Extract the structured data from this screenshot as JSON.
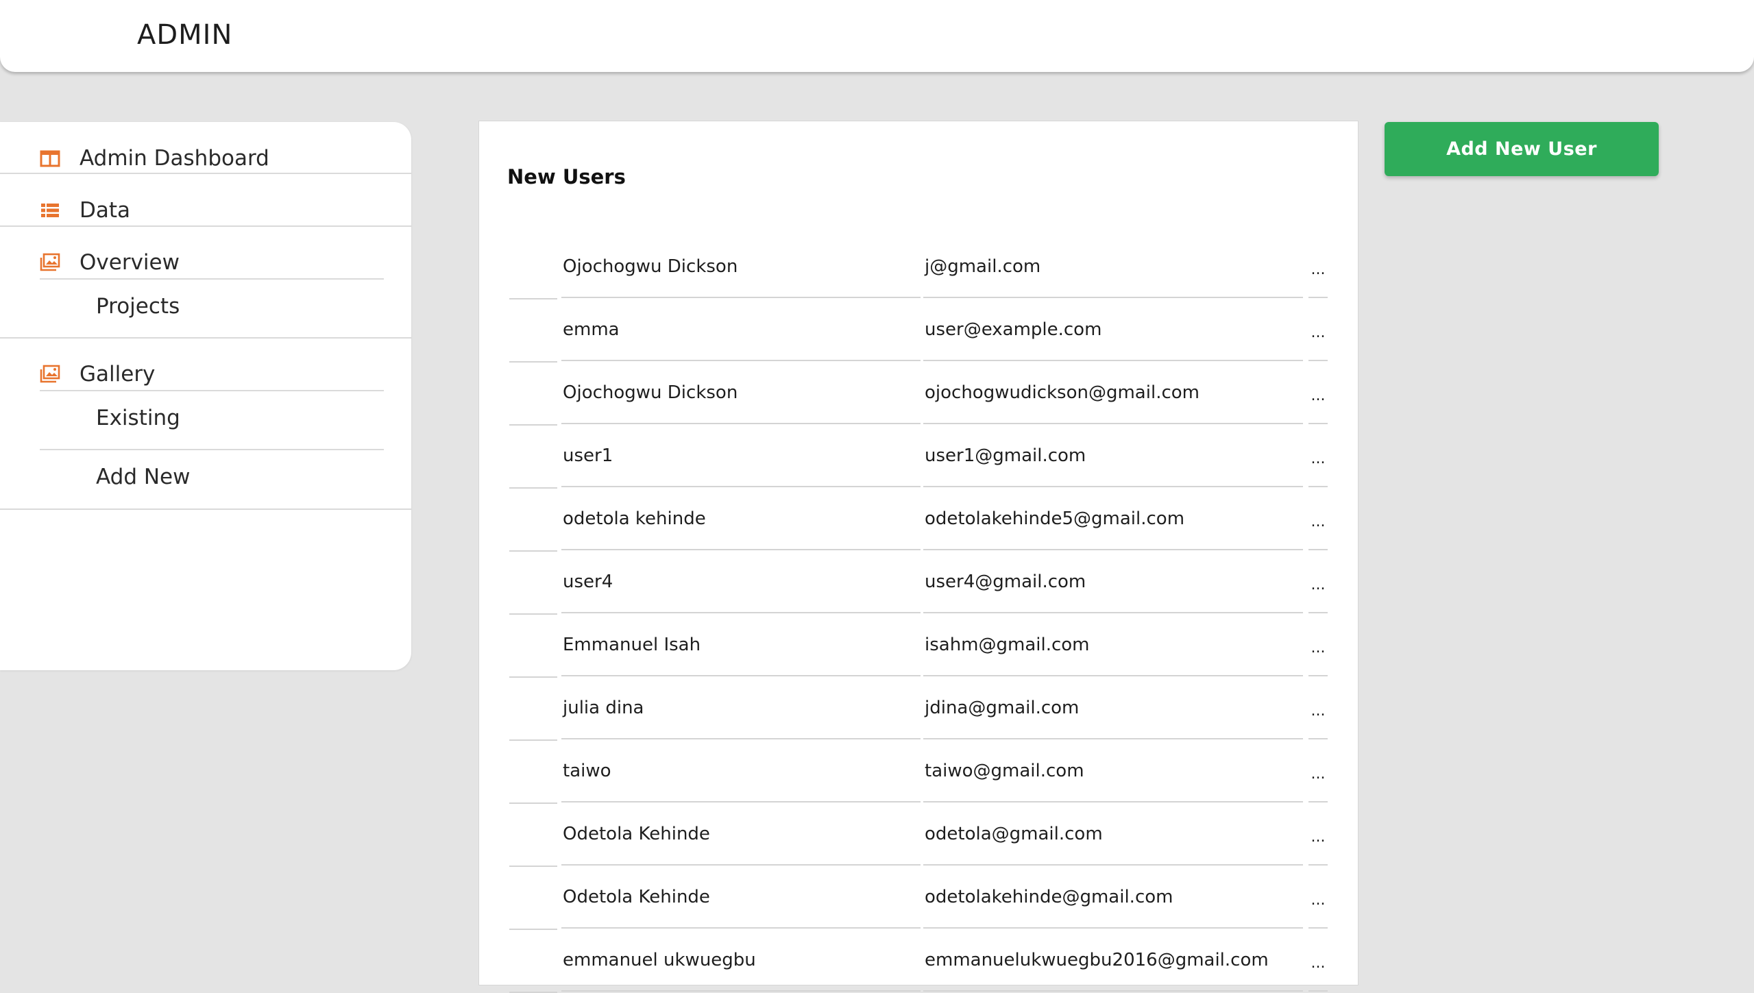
{
  "header": {
    "title": "ADMIN"
  },
  "sidebar": {
    "items": [
      {
        "label": "Admin Dashboard",
        "icon": "columns-icon"
      },
      {
        "label": "Data",
        "icon": "list-icon"
      },
      {
        "label": "Overview",
        "icon": "images-icon"
      },
      {
        "label": "Projects"
      },
      {
        "label": "Gallery",
        "icon": "images-icon"
      },
      {
        "label": "Existing"
      },
      {
        "label": "Add New"
      }
    ],
    "accent": "#e8742e"
  },
  "main": {
    "title": "New Users",
    "users": [
      {
        "name": "Ojochogwu Dickson",
        "email": "j@gmail.com",
        "action": "..."
      },
      {
        "name": "emma",
        "email": "user@example.com",
        "action": "..."
      },
      {
        "name": "Ojochogwu Dickson",
        "email": "ojochogwudickson@gmail.com",
        "action": "..."
      },
      {
        "name": "user1",
        "email": "user1@gmail.com",
        "action": "..."
      },
      {
        "name": "odetola kehinde",
        "email": "odetolakehinde5@gmail.com",
        "action": "..."
      },
      {
        "name": "user4",
        "email": "user4@gmail.com",
        "action": "..."
      },
      {
        "name": "Emmanuel Isah",
        "email": "isahm@gmail.com",
        "action": "..."
      },
      {
        "name": "julia dina",
        "email": "jdina@gmail.com",
        "action": "..."
      },
      {
        "name": "taiwo",
        "email": "taiwo@gmail.com",
        "action": "..."
      },
      {
        "name": "Odetola Kehinde",
        "email": "odetola@gmail.com",
        "action": "..."
      },
      {
        "name": "Odetola Kehinde",
        "email": "odetolakehinde@gmail.com",
        "action": "..."
      },
      {
        "name": "emmanuel ukwuegbu",
        "email": "emmanuelukwuegbu2016@gmail.com",
        "action": "..."
      }
    ]
  },
  "actions": {
    "add_user_label": "Add New User",
    "add_user_color": "#2fac5a"
  }
}
